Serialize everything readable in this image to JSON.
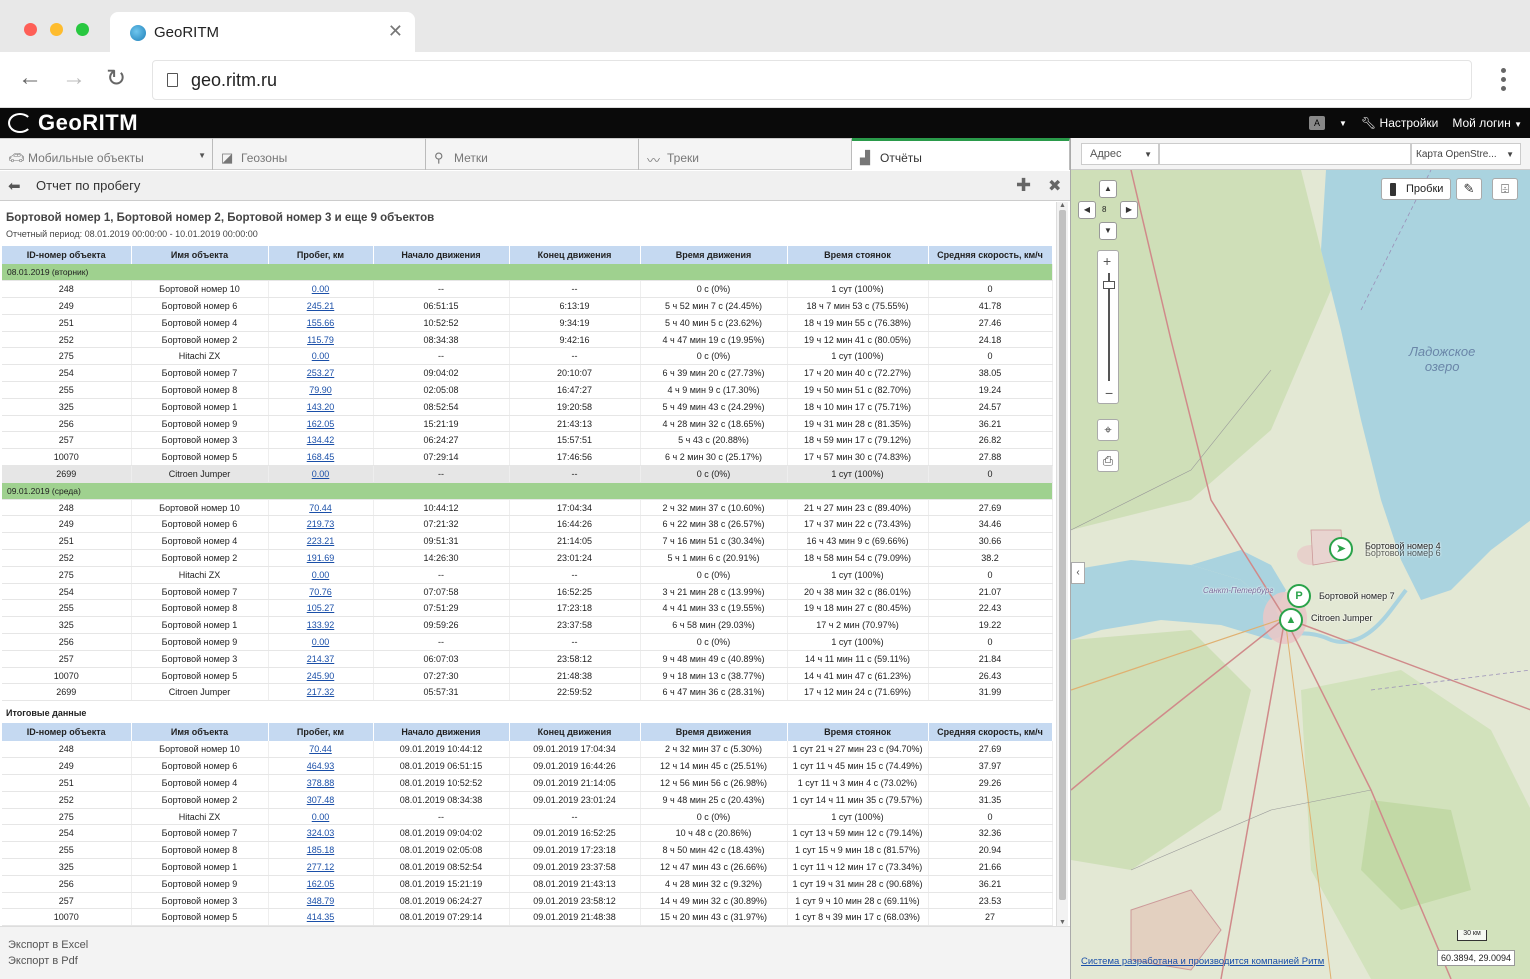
{
  "browser": {
    "tab_title": "GeoRITM",
    "url": "geo.ritm.ru"
  },
  "app": {
    "logo": "GeoRITM",
    "settings_label": "Настройки",
    "login_label": "Мой логин"
  },
  "nav_tabs": [
    {
      "label": "Мобильные объекты",
      "icon": "car-icon"
    },
    {
      "label": "Геозоны",
      "icon": "geozone-icon"
    },
    {
      "label": "Метки",
      "icon": "pin-icon"
    },
    {
      "label": "Треки",
      "icon": "track-icon"
    },
    {
      "label": "Отчёты",
      "icon": "chart-icon"
    }
  ],
  "report": {
    "title": "Отчет по пробегу",
    "heading": "Бортовой номер 1, Бортовой номер 2, Бортовой номер 3 и еще 9 объектов",
    "period": "Отчетный период: 08.01.2019 00:00:00 - 10.01.2019 00:00:00",
    "columns": [
      "ID-номер  объекта",
      "Имя  объекта",
      "Пробег, км",
      "Начало движения",
      "Конец движения",
      "Время движения",
      "Время стоянок",
      "Средняя скорость, км/ч"
    ],
    "groups": [
      {
        "label": "08.01.2019 (вторник)",
        "rows": [
          [
            "248",
            "Бортовой номер 10",
            "0.00",
            "--",
            "--",
            "0 с (0%)",
            "1 сут (100%)",
            "0"
          ],
          [
            "249",
            "Бортовой номер 6",
            "245.21",
            "06:51:15",
            "6:13:19",
            "5 ч 52 мин 7 с (24.45%)",
            "18 ч 7 мин 53 с (75.55%)",
            "41.78"
          ],
          [
            "251",
            "Бортовой номер 4",
            "155.66",
            "10:52:52",
            "9:34:19",
            "5 ч 40 мин 5 с (23.62%)",
            "18 ч 19 мин 55 с (76.38%)",
            "27.46"
          ],
          [
            "252",
            "Бортовой номер 2",
            "115.79",
            "08:34:38",
            "9:42:16",
            "4 ч 47 мин 19 с (19.95%)",
            "19 ч 12 мин 41 с (80.05%)",
            "24.18"
          ],
          [
            "275",
            "Hitachi ZX",
            "0.00",
            "--",
            "--",
            "0 с (0%)",
            "1 сут (100%)",
            "0"
          ],
          [
            "254",
            "Бортовой номер 7",
            "253.27",
            "09:04:02",
            "20:10:07",
            "6 ч 39 мин 20 с (27.73%)",
            "17 ч 20 мин 40 с (72.27%)",
            "38.05"
          ],
          [
            "255",
            "Бортовой номер 8",
            "79.90",
            "02:05:08",
            "16:47:27",
            "4 ч 9 мин 9 с (17.30%)",
            "19 ч 50 мин 51 с (82.70%)",
            "19.24"
          ],
          [
            "325",
            "Бортовой номер 1",
            "143.20",
            "08:52:54",
            "19:20:58",
            "5 ч 49 мин 43 с (24.29%)",
            "18 ч 10 мин 17 с (75.71%)",
            "24.57"
          ],
          [
            "256",
            "Бортовой номер 9",
            "162.05",
            "15:21:19",
            "21:43:13",
            "4 ч 28 мин 32 с (18.65%)",
            "19 ч 31 мин 28 с (81.35%)",
            "36.21"
          ],
          [
            "257",
            "Бортовой номер 3",
            "134.42",
            "06:24:27",
            "15:57:51",
            "5 ч 43 с (20.88%)",
            "18 ч 59 мин 17 с (79.12%)",
            "26.82"
          ],
          [
            "10070",
            "Бортовой номер 5",
            "168.45",
            "07:29:14",
            "17:46:56",
            "6 ч 2 мин 30 с (25.17%)",
            "17 ч 57 мин 30 с (74.83%)",
            "27.88"
          ],
          [
            "2699",
            "Citroen Jumper",
            "0.00",
            "--",
            "--",
            "0 с (0%)",
            "1 сут (100%)",
            "0"
          ]
        ]
      },
      {
        "label": "09.01.2019 (среда)",
        "rows": [
          [
            "248",
            "Бортовой номер 10",
            "70.44",
            "10:44:12",
            "17:04:34",
            "2 ч 32 мин 37 с (10.60%)",
            "21 ч 27 мин 23 с (89.40%)",
            "27.69"
          ],
          [
            "249",
            "Бортовой номер 6",
            "219.73",
            "07:21:32",
            "16:44:26",
            "6 ч 22 мин 38 с (26.57%)",
            "17 ч 37 мин 22 с (73.43%)",
            "34.46"
          ],
          [
            "251",
            "Бортовой номер 4",
            "223.21",
            "09:51:31",
            "21:14:05",
            "7 ч 16 мин 51 с (30.34%)",
            "16 ч 43 мин 9 с (69.66%)",
            "30.66"
          ],
          [
            "252",
            "Бортовой номер 2",
            "191.69",
            "14:26:30",
            "23:01:24",
            "5 ч 1 мин 6 с (20.91%)",
            "18 ч 58 мин 54 с (79.09%)",
            "38.2"
          ],
          [
            "275",
            "Hitachi ZX",
            "0.00",
            "--",
            "--",
            "0 с (0%)",
            "1 сут (100%)",
            "0"
          ],
          [
            "254",
            "Бортовой номер 7",
            "70.76",
            "07:07:58",
            "16:52:25",
            "3 ч 21 мин 28 с (13.99%)",
            "20 ч 38 мин 32 с (86.01%)",
            "21.07"
          ],
          [
            "255",
            "Бортовой номер 8",
            "105.27",
            "07:51:29",
            "17:23:18",
            "4 ч 41 мин 33 с (19.55%)",
            "19 ч 18 мин 27 с (80.45%)",
            "22.43"
          ],
          [
            "325",
            "Бортовой номер 1",
            "133.92",
            "09:59:26",
            "23:37:58",
            "6 ч 58 мин  (29.03%)",
            "17 ч 2 мин  (70.97%)",
            "19.22"
          ],
          [
            "256",
            "Бортовой номер 9",
            "0.00",
            "--",
            "--",
            "0 с (0%)",
            "1 сут (100%)",
            "0"
          ],
          [
            "257",
            "Бортовой номер 3",
            "214.37",
            "06:07:03",
            "23:58:12",
            "9 ч 48 мин 49 с (40.89%)",
            "14 ч 11 мин 11 с (59.11%)",
            "21.84"
          ],
          [
            "10070",
            "Бортовой номер 5",
            "245.90",
            "07:27:30",
            "21:48:38",
            "9 ч 18 мин 13 с (38.77%)",
            "14 ч 41 мин 47 с (61.23%)",
            "26.43"
          ],
          [
            "2699",
            "Citroen Jumper",
            "217.32",
            "05:57:31",
            "22:59:52",
            "6 ч 47 мин 36 с (28.31%)",
            "17 ч 12 мин 24 с (71.69%)",
            "31.99"
          ]
        ]
      }
    ],
    "summary_label": "Итоговые данные",
    "summary_rows": [
      [
        "248",
        "Бортовой номер 10",
        "70.44",
        "09.01.2019 10:44:12",
        "09.01.2019 17:04:34",
        "2 ч 32 мин 37 с (5.30%)",
        "1 сут 21 ч 27 мин 23 с (94.70%)",
        "27.69"
      ],
      [
        "249",
        "Бортовой номер 6",
        "464.93",
        "08.01.2019 06:51:15",
        "09.01.2019 16:44:26",
        "12 ч 14 мин 45 с (25.51%)",
        "1 сут 11 ч 45 мин 15 с (74.49%)",
        "37.97"
      ],
      [
        "251",
        "Бортовой номер 4",
        "378.88",
        "08.01.2019 10:52:52",
        "09.01.2019 21:14:05",
        "12 ч 56 мин 56 с (26.98%)",
        "1 сут 11 ч 3 мин 4 с (73.02%)",
        "29.26"
      ],
      [
        "252",
        "Бортовой номер 2",
        "307.48",
        "08.01.2019 08:34:38",
        "09.01.2019 23:01:24",
        "9 ч 48 мин 25 с (20.43%)",
        "1 сут 14 ч 11 мин 35 с (79.57%)",
        "31.35"
      ],
      [
        "275",
        "Hitachi ZX",
        "0.00",
        "--",
        "--",
        "0 с (0%)",
        "1 сут (100%)",
        "0"
      ],
      [
        "254",
        "Бортовой номер 7",
        "324.03",
        "08.01.2019 09:04:02",
        "09.01.2019 16:52:25",
        "10 ч 48 с (20.86%)",
        "1 сут 13 ч 59 мин 12 с (79.14%)",
        "32.36"
      ],
      [
        "255",
        "Бортовой номер 8",
        "185.18",
        "08.01.2019 02:05:08",
        "09.01.2019 17:23:18",
        "8 ч 50 мин 42 с (18.43%)",
        "1 сут 15 ч 9 мин 18 с (81.57%)",
        "20.94"
      ],
      [
        "325",
        "Бортовой номер 1",
        "277.12",
        "08.01.2019 08:52:54",
        "09.01.2019 23:37:58",
        "12 ч 47 мин 43 с (26.66%)",
        "1 сут 11 ч 12 мин 17 с (73.34%)",
        "21.66"
      ],
      [
        "256",
        "Бортовой номер 9",
        "162.05",
        "08.01.2019 15:21:19",
        "08.01.2019 21:43:13",
        "4 ч 28 мин 32 с (9.32%)",
        "1 сут 19 ч 31 мин 28 с (90.68%)",
        "36.21"
      ],
      [
        "257",
        "Бортовой номер 3",
        "348.79",
        "08.01.2019 06:24:27",
        "09.01.2019 23:58:12",
        "14 ч 49 мин 32 с (30.89%)",
        "1 сут 9 ч 10 мин 28 с (69.11%)",
        "23.53"
      ],
      [
        "10070",
        "Бортовой номер 5",
        "414.35",
        "08.01.2019 07:29:14",
        "09.01.2019 21:48:38",
        "15 ч 20 мин 43 с (31.97%)",
        "1 сут 8 ч 39 мин 17 с (68.03%)",
        "27"
      ]
    ]
  },
  "export": {
    "excel": "Экспорт в Excel",
    "pdf": "Экспорт в Pdf"
  },
  "map": {
    "address_label": "Адрес",
    "layer_label": "Карта OpenStre...",
    "traffic_label": "Пробки",
    "zoom_level": "8",
    "lake_label_1": "Ладожское",
    "lake_label_2": "озеро",
    "city_label": "Санкт-Петербург",
    "markers": [
      {
        "label": "Бортовой номер 4",
        "symbol": "➤"
      },
      {
        "label": "Бортовой номер 6",
        "symbol": ""
      },
      {
        "label": "Бортовой номер 7",
        "symbol": "P"
      },
      {
        "label": "Citroen Jumper",
        "symbol": "▲"
      }
    ],
    "scale_label": "30 км",
    "coords": "60.3894, 29.0094",
    "credits": "Система разработана и производится компанией Ритм",
    "colors": {
      "water": "#aad3df",
      "land": "#e3e8d4",
      "forest": "#c9dcb2",
      "road": "#d08a8a"
    }
  }
}
